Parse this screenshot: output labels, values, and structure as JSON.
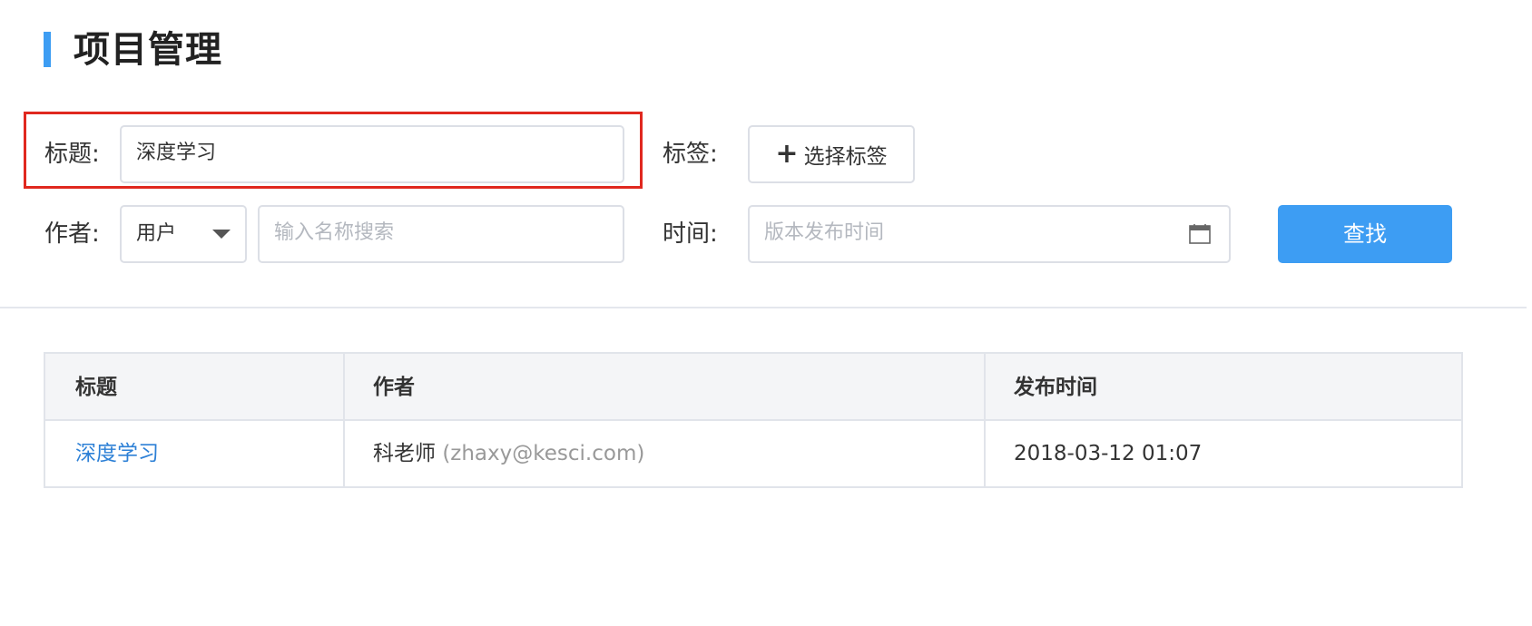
{
  "header": {
    "title": "项目管理"
  },
  "filters": {
    "title_label": "标题:",
    "title_value": "深度学习",
    "tag_label": "标签:",
    "tag_button_label": "选择标签",
    "author_label": "作者:",
    "author_type": {
      "selected": "用户"
    },
    "author_search_placeholder": "输入名称搜索",
    "time_label": "时间:",
    "time_placeholder": "版本发布时间",
    "search_button_label": "查找"
  },
  "table": {
    "columns": [
      "标题",
      "作者",
      "发布时间"
    ],
    "rows": [
      {
        "title": "深度学习",
        "author_name": "科老师",
        "author_email": "(zhaxy@kesci.com)",
        "published": "2018-03-12 01:07"
      }
    ]
  },
  "colors": {
    "accent": "#3d9df3",
    "highlight": "#e0281f",
    "link": "#2d80d6"
  },
  "icons": {
    "tag_button": "plus-icon",
    "author_select": "caret-down-icon",
    "time_field": "calendar-icon"
  }
}
